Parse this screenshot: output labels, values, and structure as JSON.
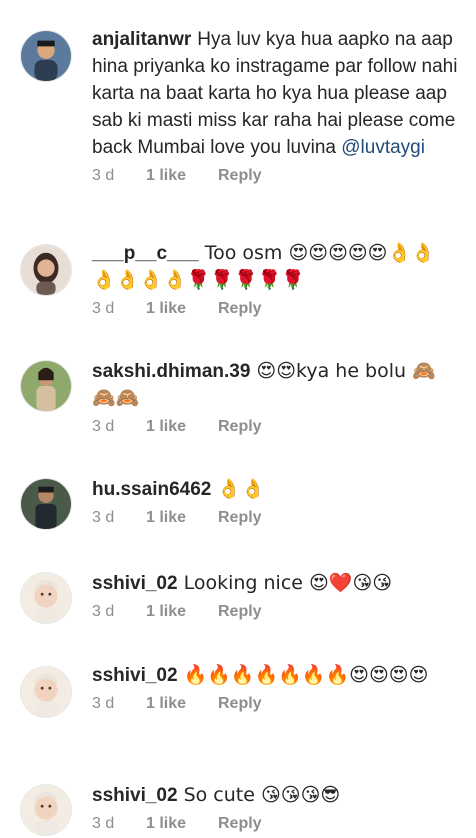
{
  "comments": [
    {
      "username": "anjalitanwr",
      "text": "Hya luv kya hua aapko na aap hina priyanka ko instragame par follow nahi karta na baat karta ho kya hua please aap sab ki masti miss kar raha hai please come back Mumbai love you luvina",
      "mention": "@luvtaygi",
      "time": "3 d",
      "likes": "1 like",
      "reply": "Reply",
      "avatar_icon": "avatar-boy-icon"
    },
    {
      "username": "___p__c___",
      "text": "Too osm 😍😍😍😍😍👌👌👌👌👌👌🌹🌹🌹🌹🌹",
      "time": "3 d",
      "likes": "1 like",
      "reply": "Reply",
      "avatar_icon": "avatar-girl-icon"
    },
    {
      "username": "sakshi.dhiman.39",
      "text": "😍😍kya he bolu 🙈🙈🙈",
      "time": "3 d",
      "likes": "1 like",
      "reply": "Reply",
      "avatar_icon": "avatar-woman-icon"
    },
    {
      "username": "hu.ssain6462",
      "text": "👌👌",
      "time": "3 d",
      "likes": "1 like",
      "reply": "Reply",
      "avatar_icon": "avatar-man-icon"
    },
    {
      "username": "sshivi_02",
      "text": "Looking nice 😍❤️😘😘",
      "time": "3 d",
      "likes": "1 like",
      "reply": "Reply",
      "avatar_icon": "avatar-baby-icon"
    },
    {
      "username": "sshivi_02",
      "text": "🔥🔥🔥🔥🔥🔥🔥😍😍😍😍",
      "time": "3 d",
      "likes": "1 like",
      "reply": "Reply",
      "avatar_icon": "avatar-baby-icon"
    },
    {
      "username": "sshivi_02",
      "text": "So cute 😘😘😘😎",
      "time": "3 d",
      "likes": "1 like",
      "reply": "Reply",
      "avatar_icon": "avatar-baby-icon"
    }
  ]
}
